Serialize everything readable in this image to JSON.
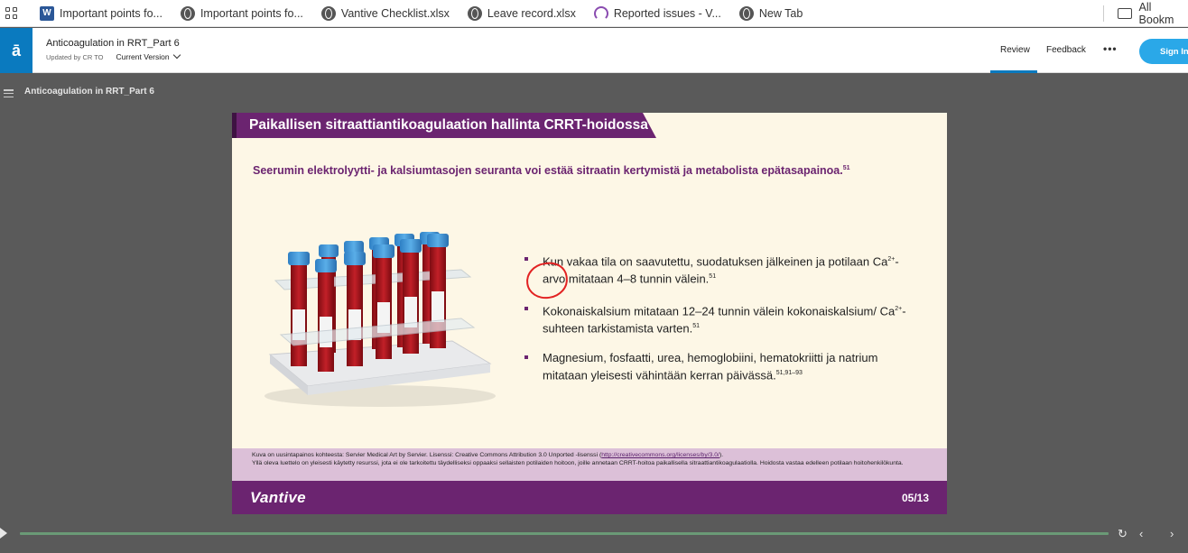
{
  "bookmarks": [
    {
      "label": "Important points fo...",
      "icon": "word-icon"
    },
    {
      "label": "Important points fo...",
      "icon": "globe-icon"
    },
    {
      "label": "Vantive Checklist.xlsx",
      "icon": "globe-icon"
    },
    {
      "label": "Leave record.xlsx",
      "icon": "globe-icon"
    },
    {
      "label": "Reported issues - V...",
      "icon": "arc-icon"
    },
    {
      "label": "New Tab",
      "icon": "globe-icon"
    }
  ],
  "all_bookmarks": "All Bookm",
  "app": {
    "logo": "ā",
    "doc_title": "Anticoagulation in RRT_Part 6",
    "updated_by": "Updated by CR TO",
    "version": "Current Version",
    "tabs": {
      "review": "Review",
      "feedback": "Feedback"
    },
    "more": "•••",
    "sign_in": "Sign In"
  },
  "player": {
    "title": "Anticoagulation in RRT_Part 6"
  },
  "slide": {
    "title": "Paikallisen sitraattiantikoagulaation hallinta CRRT-hoidossa",
    "subtitle": "Seerumin elektrolyytti- ja kalsiumtasojen seuranta voi estää sitraatin kertymistä ja metabolista epätasapainoa.",
    "subtitle_ref": "51",
    "bullets": [
      {
        "text_a": "Kun vakaa tila on saavutettu, suodatuksen jälkeinen ja potilaan Ca",
        "sup_a": "2+",
        "text_b": "-arvo mitataan 4–8 tunnin välein.",
        "ref": "51"
      },
      {
        "text_a": "Kokonaiskalsium mitataan 12–24 tunnin välein kokonaiskalsium/ Ca",
        "sup_a": "2+",
        "text_b": "-suhteen tarkistamista varten.",
        "ref": "51"
      },
      {
        "text_a": "Magnesium, fosfaatti, urea, hemoglobiini, hematokriitti ja natrium mitataan yleisesti vähintään kerran päivässä.",
        "sup_a": "",
        "text_b": "",
        "ref": "51,91–93"
      }
    ],
    "footnote_1a": "Kuva on uusintapainos kohteesta: Servier Medical Art by Servier. Lisenssi: Creative Commons Attribution 3.0 Unported -lisenssi (",
    "footnote_link": "http://creativecommons.org/licenses/by/3.0/",
    "footnote_1b": ").",
    "footnote_2": "Yllä oleva luettelo on yleisesti käytetty resurssi, jota ei ole tarkoitettu täydelliseksi oppaaksi sellaisten potilaiden hoitoon, joille annetaan CRRT-hoitoa paikallisella sitraattiantikoagulaatiolla. Hoidosta vastaa edelleen potilaan hoitohenkilökunta.",
    "brand": "Vantive",
    "page": "05/13"
  },
  "colors": {
    "purple": "#6b2470",
    "accent_blue": "#0a7abf",
    "annotation_red": "#e22222",
    "tube_cap": "#3d8fd1",
    "blood": "#a8141b"
  }
}
